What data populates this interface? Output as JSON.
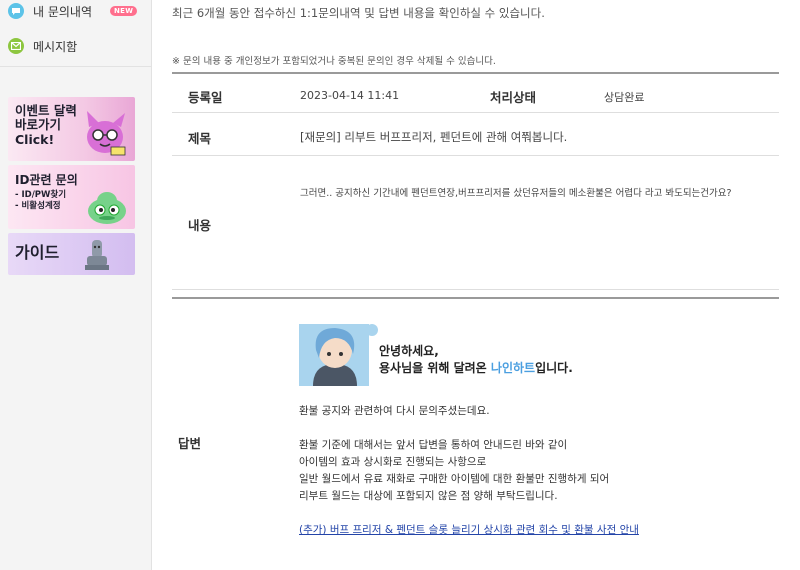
{
  "sidebar": {
    "inquiry_label": "내 문의내역",
    "new_badge": "NEW",
    "message_label": "메시지함",
    "banners": [
      {
        "line1": "이벤트 달력",
        "line2": "바로가기",
        "line3": "Click!"
      },
      {
        "line1": "ID관련 문의",
        "line2": "- ID/PW찾기",
        "line3": "- 비활성계정"
      },
      {
        "line1": "가이드"
      }
    ]
  },
  "main": {
    "intro": "최근 6개월 동안 접수하신 1:1문의내역 및 답변 내용을 확인하실 수 있습니다.",
    "notice": "※ 문의 내용 중 개인정보가 포함되었거나 중복된 문의인 경우 삭제될 수 있습니다.",
    "date_label": "등록일",
    "date_value": "2023-04-14 11:41",
    "status_label": "처리상태",
    "status_value": "상담완료",
    "title_label": "제목",
    "title_value": "[재문의] 리부트 버프프리저, 펜던트에 관해 여쭤봅니다.",
    "content_label": "내용",
    "content_value": "그러면.. 공지하신 기간내에 펜던트연장,버프프리저를 샀던유저들의 메소환불은 어렵다 라고 봐도되는건가요?",
    "answer_label": "답변",
    "answer_image": {
      "greeting": "안녕하세요,",
      "line2_prefix": "용사님을 위해 달려온 ",
      "line2_name": "나인하트",
      "line2_suffix": "입니다."
    },
    "answer_lines": [
      "환불 공지와 관련하여 다시 문의주셨는데요.",
      "환불 기준에 대해서는 앞서 답변을 통하여 안내드린 바와 같이",
      "아이템의 효과 상시화로 진행되는 사항으로",
      "일반 월드에서 유료 재화로 구매한 아이템에 대한 환불만 진행하게 되어",
      "리부트 월드는 대상에 포함되지 않은 점 양해 부탁드립니다."
    ],
    "answer_link": "(추가) 버프 프리저 & 펜던트 슬롯 늘리기 상시화 관련 회수 및 환불 사전 안내"
  },
  "colors": {
    "badge": "#ff6f8d",
    "link": "#2344a8",
    "highlight": "#4b9fe0"
  }
}
